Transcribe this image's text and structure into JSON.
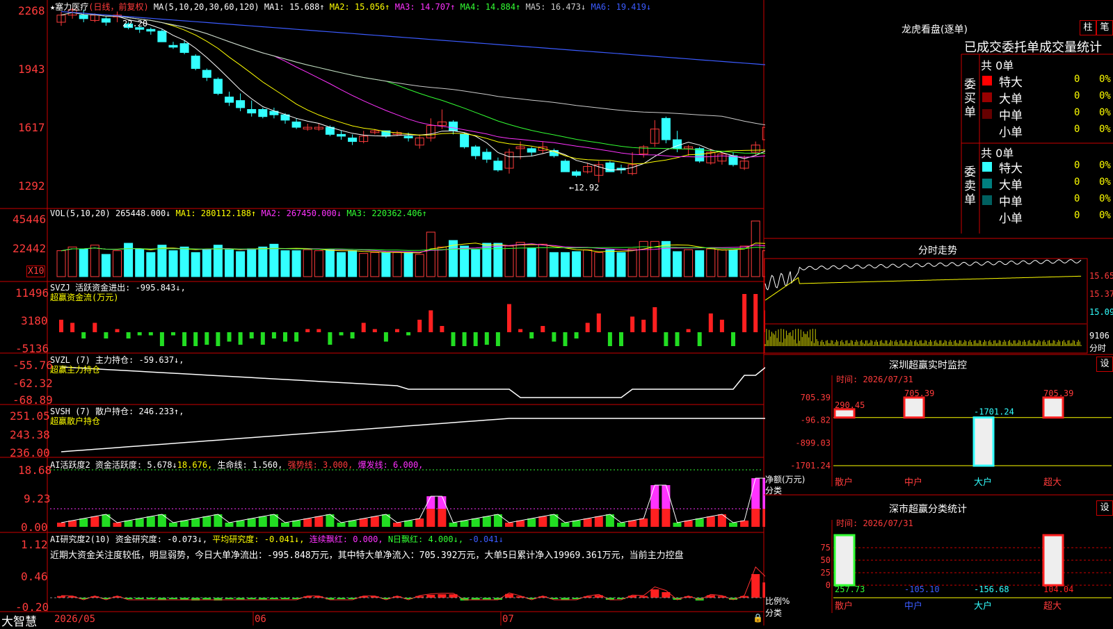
{
  "stock": {
    "title": "★塞力医疗",
    "period": "(日线，前复权)"
  },
  "main": {
    "ma_label": "MA(5,10,20,30,60,120)",
    "ma": [
      {
        "name": "MA1",
        "value": "15.688",
        "dir": "↑",
        "color": "#ffffff"
      },
      {
        "name": "MA2",
        "value": "15.056",
        "dir": "↑",
        "color": "#ffff00"
      },
      {
        "name": "MA3",
        "value": "14.707",
        "dir": "↑",
        "color": "#ff33ff"
      },
      {
        "name": "MA4",
        "value": "14.884",
        "dir": "↑",
        "color": "#33ff33"
      },
      {
        "name": "MA5",
        "value": "16.473",
        "dir": "↓",
        "color": "#cccccc"
      },
      {
        "name": "MA6",
        "value": "19.419",
        "dir": "↓",
        "color": "#3b5bff"
      }
    ],
    "ticks": [
      "2268",
      "1943",
      "1617",
      "1292"
    ],
    "high_label": "22.20",
    "low_label": "←12.92"
  },
  "volume": {
    "label": "VOL(5,10,20)",
    "value": "265448.000↓",
    "ma1": "MA1: 280112.188↑",
    "ma2": "MA2: 267450.000↓",
    "ma3": "MA3: 220362.406↑",
    "ticks": [
      "45446",
      "22442"
    ],
    "unit": "X10"
  },
  "svzj": {
    "label": "SVZJ  活跃资金进出: -995.843↓,",
    "sub": "超赢资金流(万元)",
    "ticks": [
      "11496",
      "3180",
      "-5136"
    ]
  },
  "svzl": {
    "label": "SVZL (7) 主力持仓: -59.637↓,",
    "sub": "超赢主力持仓",
    "ticks": [
      "-55.76",
      "-62.32",
      "-68.89"
    ]
  },
  "svsh": {
    "label": "SVSH (7) 散户持仓: 246.233↑,",
    "sub": "超赢散户持仓",
    "ticks": [
      "251.05",
      "243.38",
      "236.00"
    ]
  },
  "ai1": {
    "label": "AI活跃度2 资金活跃度: 5.678↓",
    "v2": "18.676,",
    "v3": "生命线: 1.560,",
    "v4": "强势线: 3.000,",
    "v5": "爆发线: 6.000,",
    "ticks": [
      "18.68",
      "9.23",
      "0.00"
    ]
  },
  "ai2": {
    "label": "AI研究度2(10) 资金研究度: -0.073↓,",
    "v2": "平均研究度: -0.041↓,",
    "v3": "连续飘红: 0.000,",
    "v4": "N日飘红: 4.000↓,",
    "v5": "-0.041↓",
    "note": "近期大资金关注度较低，明显弱势，今日大单净流出：-995.848万元，其中特大单净流入：705.392万元，大单5日累计净入19969.361万元，当前主力控盘",
    "ticks": [
      "1.12",
      "0.46",
      "-0.20"
    ]
  },
  "footer": {
    "brand": "大智慧",
    "dates": [
      "2026/05",
      "06",
      "07"
    ]
  },
  "right": {
    "lhkp_title": "龙虎看盘(逐单)",
    "tab_bar": "柱",
    "tab_pen": "笔",
    "order_title": "已成交委托单成交量统计",
    "buy": {
      "label": "委买单",
      "total": "共 0单",
      "rows": [
        {
          "name": "特大",
          "qty": "0",
          "pct": "0%",
          "color": "#ff0000"
        },
        {
          "name": "大单",
          "qty": "0",
          "pct": "0%",
          "color": "#990000"
        },
        {
          "name": "中单",
          "qty": "0",
          "pct": "0%",
          "color": "#660000"
        },
        {
          "name": "小单",
          "qty": "0",
          "pct": "0%",
          "color": "#000000"
        }
      ]
    },
    "sell": {
      "label": "委卖单",
      "total": "共 0单",
      "rows": [
        {
          "name": "特大",
          "qty": "0",
          "pct": "0%",
          "color": "#33ffff"
        },
        {
          "name": "大单",
          "qty": "0",
          "pct": "0%",
          "color": "#008080"
        },
        {
          "name": "中单",
          "qty": "0",
          "pct": "0%",
          "color": "#006060"
        },
        {
          "name": "小单",
          "qty": "0",
          "pct": "0%",
          "color": "#000000"
        }
      ]
    },
    "intraday": {
      "title": "分时走势",
      "prices": [
        "15.65",
        "15.37",
        "15.09"
      ],
      "vol": "9106",
      "unit": "分时"
    },
    "monitor": {
      "title": "深圳超赢实时监控",
      "set": "设",
      "time": "时间: 2026/07/31",
      "yticks": [
        "705.39",
        "-96.82",
        "-899.03",
        "-1701.24"
      ],
      "ylabel": "净额(万元)",
      "xlabel": "分类",
      "cats": [
        "散户",
        "中户",
        "大户",
        "超大"
      ],
      "values": [
        290.45,
        705.39,
        -1701.24,
        705.39
      ],
      "value_labels": [
        "290.45",
        "705.39",
        "-1701.24",
        "705.39"
      ]
    },
    "classify": {
      "title": "深市超赢分类统计",
      "set": "设",
      "time": "时间: 2026/07/31",
      "yticks": [
        "75",
        "50",
        "25",
        "0"
      ],
      "ylabel": "比例%",
      "xlabel": "分类",
      "cats": [
        "散户",
        "中户",
        "大户",
        "超大"
      ],
      "values": [
        "257.73",
        "-105.10",
        "-156.68",
        "104.04"
      ]
    }
  },
  "chart_data": {
    "type": "candlestick",
    "title": "塞力医疗 日线 前复权",
    "ylim": [
      12.92,
      22.68
    ],
    "candles": [
      [
        21.9,
        22.3,
        22.5,
        21.7
      ],
      [
        22.3,
        22.6,
        22.7,
        22.1
      ],
      [
        22.3,
        22.1,
        22.6,
        21.9
      ],
      [
        22.0,
        22.3,
        22.4,
        21.9
      ],
      [
        22.1,
        21.9,
        22.2,
        21.7
      ],
      [
        22.2,
        22.3,
        22.5,
        21.9
      ],
      [
        21.8,
        21.6,
        21.9,
        21.5
      ],
      [
        21.6,
        21.5,
        21.7,
        21.3
      ],
      [
        21.5,
        21.4,
        21.6,
        21.2
      ],
      [
        21.4,
        20.8,
        21.5,
        20.8
      ],
      [
        20.6,
        20.5,
        20.8,
        20.4
      ],
      [
        20.7,
        20.2,
        20.9,
        20.1
      ],
      [
        20.0,
        19.3,
        20.1,
        19.2
      ],
      [
        19.2,
        18.8,
        19.3,
        18.6
      ],
      [
        18.7,
        17.9,
        18.8,
        17.8
      ],
      [
        17.7,
        17.4,
        18.0,
        17.2
      ],
      [
        17.5,
        17.1,
        17.9,
        16.9
      ],
      [
        17.0,
        16.8,
        17.5,
        16.6
      ],
      [
        17.0,
        16.6,
        17.1,
        16.5
      ],
      [
        16.9,
        16.7,
        17.1,
        16.5
      ],
      [
        16.7,
        16.4,
        16.8,
        16.2
      ],
      [
        16.3,
        16.0,
        16.5,
        15.9
      ],
      [
        15.9,
        16.0,
        16.2,
        15.8
      ],
      [
        15.9,
        16.0,
        16.2,
        15.8
      ],
      [
        16.0,
        15.6,
        16.1,
        15.5
      ],
      [
        15.6,
        15.5,
        15.8,
        15.3
      ],
      [
        15.4,
        15.2,
        15.6,
        15.0
      ],
      [
        15.2,
        15.5,
        15.8,
        15.1
      ],
      [
        15.7,
        15.8,
        15.9,
        15.6
      ],
      [
        15.8,
        15.5,
        15.8,
        15.4
      ],
      [
        15.6,
        15.7,
        15.8,
        15.5
      ],
      [
        15.5,
        15.4,
        15.7,
        15.2
      ],
      [
        15.0,
        15.4,
        15.6,
        14.8
      ],
      [
        15.4,
        16.1,
        16.5,
        15.2
      ],
      [
        16.1,
        16.3,
        17.0,
        15.9
      ],
      [
        16.3,
        15.8,
        16.4,
        15.6
      ],
      [
        15.6,
        14.9,
        15.7,
        14.8
      ],
      [
        14.9,
        14.4,
        15.0,
        14.2
      ],
      [
        14.6,
        14.2,
        14.8,
        14.0
      ],
      [
        14.1,
        13.6,
        14.3,
        13.5
      ],
      [
        13.7,
        14.6,
        14.8,
        13.4
      ],
      [
        14.8,
        14.9,
        15.2,
        14.2
      ],
      [
        14.8,
        14.6,
        14.9,
        14.4
      ],
      [
        14.7,
        14.9,
        15.2,
        14.5
      ],
      [
        14.7,
        14.4,
        14.8,
        14.3
      ],
      [
        14.1,
        13.5,
        14.2,
        13.5
      ],
      [
        13.5,
        13.3,
        13.6,
        13.2
      ],
      [
        13.5,
        13.8,
        14.0,
        13.4
      ],
      [
        13.3,
        13.9,
        14.1,
        12.9
      ],
      [
        14.0,
        13.5,
        14.1,
        13.5
      ],
      [
        13.7,
        13.6,
        13.9,
        13.4
      ],
      [
        13.4,
        13.9,
        14.6,
        13.3
      ],
      [
        14.5,
        14.9,
        15.0,
        14.3
      ],
      [
        15.1,
        15.9,
        16.4,
        14.9
      ],
      [
        16.5,
        15.3,
        16.6,
        15.1
      ],
      [
        15.3,
        14.8,
        15.8,
        14.6
      ],
      [
        14.8,
        14.9,
        15.0,
        14.4
      ],
      [
        14.8,
        14.1,
        14.9,
        14.0
      ],
      [
        14.0,
        14.6,
        14.8,
        13.9
      ],
      [
        14.1,
        14.5,
        14.6,
        13.9
      ],
      [
        14.4,
        13.9,
        14.6,
        13.8
      ],
      [
        13.7,
        14.1,
        14.4,
        13.6
      ],
      [
        14.6,
        15.0,
        15.2,
        14.4
      ],
      [
        15.3,
        16.0,
        16.3,
        15.2
      ],
      [
        16.1,
        15.2,
        16.2,
        14.9
      ],
      [
        15.5,
        15.2,
        15.6,
        15.1
      ],
      [
        15.4,
        15.9,
        16.0,
        15.2
      ]
    ],
    "volumes": [
      2.8,
      3.2,
      3.0,
      3.4,
      2.4,
      2.8,
      3.6,
      3.0,
      2.6,
      3.4,
      2.8,
      3.2,
      2.6,
      2.9,
      3.4,
      2.9,
      2.7,
      3.0,
      3.2,
      3.5,
      2.8,
      2.8,
      2.9,
      2.8,
      2.9,
      2.6,
      2.8,
      2.5,
      2.6,
      2.6,
      2.6,
      2.6,
      2.4,
      4.8,
      3.2,
      3.9,
      3.3,
      2.9,
      3.6,
      3.6,
      3.3,
      3.7,
      3.1,
      3.5,
      2.6,
      2.6,
      2.7,
      2.9,
      2.6,
      2.9,
      2.6,
      3.0,
      3.8,
      3.8,
      3.8,
      2.7,
      2.9,
      2.8,
      3.0,
      2.9,
      2.9,
      3.3,
      6.0,
      2.8,
      3.6,
      4.3,
      4.5
    ]
  }
}
